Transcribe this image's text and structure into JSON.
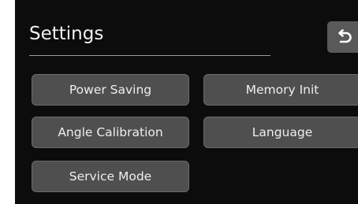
{
  "header": {
    "title": "Settings",
    "back_icon": "undo-arrow-icon"
  },
  "buttons": {
    "power_saving": "Power Saving",
    "memory_init": "Memory Init",
    "angle_calibration": "Angle Calibration",
    "language": "Language",
    "service_mode": "Service Mode"
  },
  "colors": {
    "screen_background": "#0c0c0c",
    "button_background": "#4f4f4f",
    "back_button_background": "#595959",
    "text": "#eeeeee"
  }
}
